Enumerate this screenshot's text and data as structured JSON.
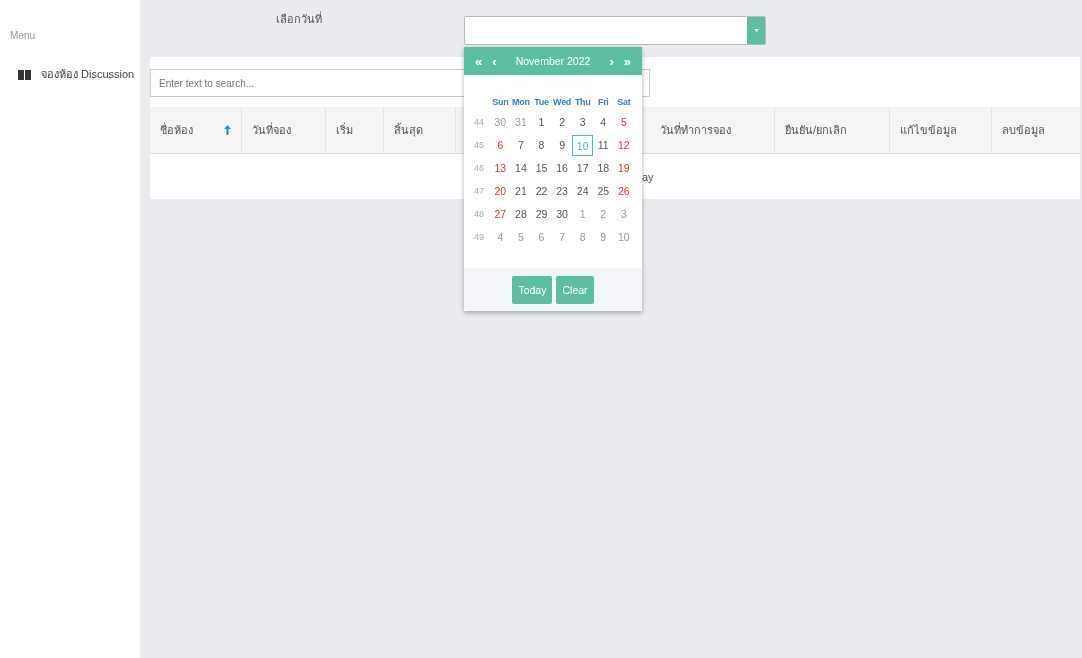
{
  "sidebar": {
    "title": "Menu",
    "items": [
      {
        "label": "จองห้อง Discussion"
      }
    ]
  },
  "date_filter": {
    "label": "เลือกวันที่"
  },
  "search": {
    "placeholder": "Enter text to search..."
  },
  "table": {
    "columns": [
      {
        "label": "ชื่อห้อง",
        "sorted": true
      },
      {
        "label": "วันที่จอง",
        "sorted": false
      },
      {
        "label": "เริ่ม",
        "sorted": false
      },
      {
        "label": "สิ้นสุด",
        "sorted": false
      },
      {
        "label": "วันที่ทำการจอง",
        "sorted": false
      },
      {
        "label": "ยืนยัน/ยกเลิก",
        "sorted": false
      },
      {
        "label": "แก้ไขข้อมูล",
        "sorted": false
      },
      {
        "label": "ลบข้อมูล",
        "sorted": false
      }
    ],
    "empty_text": "ay"
  },
  "calendar": {
    "nav": {
      "prev_year": "«",
      "prev_month": "‹",
      "title": "November 2022",
      "next_month": "›",
      "next_year": "»"
    },
    "weekdays": [
      "Sun",
      "Mon",
      "Tue",
      "Wed",
      "Thu",
      "Fri",
      "Sat"
    ],
    "weeks": [
      {
        "number": "44",
        "days": [
          {
            "label": "30",
            "muted": true,
            "today": false
          },
          {
            "label": "31",
            "muted": true,
            "today": false
          },
          {
            "label": "1",
            "muted": false,
            "weekend": false,
            "today": false
          },
          {
            "label": "2",
            "muted": false,
            "weekend": false,
            "today": false
          },
          {
            "label": "3",
            "muted": false,
            "weekend": false,
            "today": false
          },
          {
            "label": "4",
            "muted": false,
            "weekend": false,
            "today": false
          },
          {
            "label": "5",
            "muted": false,
            "weekend": true,
            "today": false
          }
        ]
      },
      {
        "number": "45",
        "days": [
          {
            "label": "6",
            "muted": false,
            "weekend": true,
            "today": false
          },
          {
            "label": "7",
            "muted": false,
            "weekend": false,
            "today": false
          },
          {
            "label": "8",
            "muted": false,
            "weekend": false,
            "today": false
          },
          {
            "label": "9",
            "muted": false,
            "weekend": false,
            "today": false
          },
          {
            "label": "10",
            "muted": false,
            "weekend": false,
            "today": true
          },
          {
            "label": "11",
            "muted": false,
            "weekend": false,
            "today": false
          },
          {
            "label": "12",
            "muted": false,
            "weekend": true,
            "today": false
          }
        ]
      },
      {
        "number": "46",
        "days": [
          {
            "label": "13",
            "muted": false,
            "weekend": true,
            "today": false
          },
          {
            "label": "14",
            "muted": false,
            "weekend": false,
            "today": false
          },
          {
            "label": "15",
            "muted": false,
            "weekend": false,
            "today": false
          },
          {
            "label": "16",
            "muted": false,
            "weekend": false,
            "today": false
          },
          {
            "label": "17",
            "muted": false,
            "weekend": false,
            "today": false
          },
          {
            "label": "18",
            "muted": false,
            "weekend": false,
            "today": false
          },
          {
            "label": "19",
            "muted": false,
            "weekend": true,
            "today": false
          }
        ]
      },
      {
        "number": "47",
        "days": [
          {
            "label": "20",
            "muted": false,
            "weekend": true,
            "today": false
          },
          {
            "label": "21",
            "muted": false,
            "weekend": false,
            "today": false
          },
          {
            "label": "22",
            "muted": false,
            "weekend": false,
            "today": false
          },
          {
            "label": "23",
            "muted": false,
            "weekend": false,
            "today": false
          },
          {
            "label": "24",
            "muted": false,
            "weekend": false,
            "today": false
          },
          {
            "label": "25",
            "muted": false,
            "weekend": false,
            "today": false
          },
          {
            "label": "26",
            "muted": false,
            "weekend": true,
            "today": false
          }
        ]
      },
      {
        "number": "48",
        "days": [
          {
            "label": "27",
            "muted": false,
            "weekend": true,
            "today": false
          },
          {
            "label": "28",
            "muted": false,
            "weekend": false,
            "today": false
          },
          {
            "label": "29",
            "muted": false,
            "weekend": false,
            "today": false
          },
          {
            "label": "30",
            "muted": false,
            "weekend": false,
            "today": false
          },
          {
            "label": "1",
            "muted": true,
            "today": false
          },
          {
            "label": "2",
            "muted": true,
            "today": false
          },
          {
            "label": "3",
            "muted": true,
            "today": false
          }
        ]
      },
      {
        "number": "49",
        "days": [
          {
            "label": "4",
            "muted": true,
            "today": false
          },
          {
            "label": "5",
            "muted": true,
            "today": false
          },
          {
            "label": "6",
            "muted": true,
            "today": false
          },
          {
            "label": "7",
            "muted": true,
            "today": false
          },
          {
            "label": "8",
            "muted": true,
            "today": false
          },
          {
            "label": "9",
            "muted": true,
            "today": false
          },
          {
            "label": "10",
            "muted": true,
            "today": false
          }
        ]
      }
    ],
    "buttons": [
      "Today",
      "Clear"
    ]
  }
}
